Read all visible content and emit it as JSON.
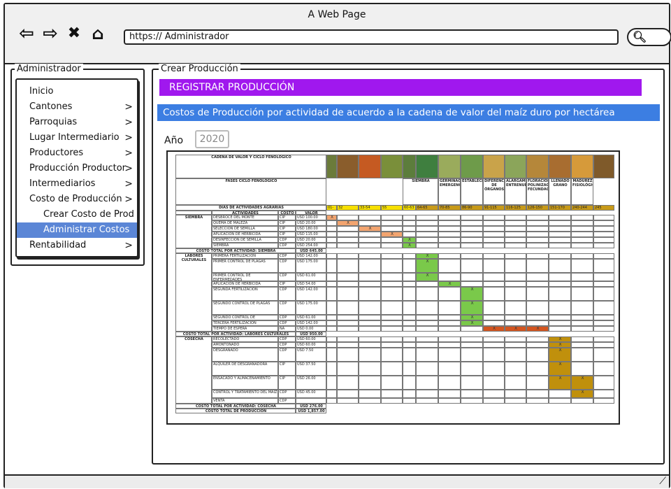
{
  "window": {
    "title": "A Web Page",
    "url": "https:// Administrador"
  },
  "sidebar": {
    "legend": "Administrador",
    "items": [
      {
        "label": "Inicio",
        "chev": ""
      },
      {
        "label": "Cantones",
        "chev": ">"
      },
      {
        "label": "Parroquias",
        "chev": ">"
      },
      {
        "label": "Lugar Intermediario",
        "chev": ">"
      },
      {
        "label": "Productores",
        "chev": ">"
      },
      {
        "label": "Producción Productor",
        "chev": ">"
      },
      {
        "label": "Intermediarios",
        "chev": ">"
      },
      {
        "label": "Costo de Producción",
        "chev": ">"
      },
      {
        "label": "Crear Costo de Prod",
        "chev": ""
      },
      {
        "label": "Administrar Costos d",
        "chev": ""
      },
      {
        "label": "Rentabilidad",
        "chev": ">"
      }
    ]
  },
  "main": {
    "legend": "Crear Producción",
    "banner_title": "REGISTRAR PRODUCCIÓN",
    "banner_subtitle": "Costos de Producción por actividad de acuerdo a la cadena de valor del maíz duro por hectárea",
    "year_label": "Año",
    "year_value": "2020"
  },
  "table": {
    "h1": "CADENA DE VALOR Y CICLO FENOLÓGICO",
    "h2": "FASES CICLO FENOLÓGICO",
    "h3": "DIAS DE ACTIVIDADES AGRARIAS",
    "col_act": "ACTIVIDADES",
    "col_cost": "COSTO",
    "col_val": "VALOR",
    "phases": [
      "SIEMBRA",
      "GERMINACIÓN EMERGENCIA",
      "ESTABLECIMIENTO",
      "DIFERENCIACIÓN DE ÓRGANOS",
      "ALARGAMIENTO ENTRENUDOS",
      "FLORACIÓN POLINIZACIÓN FECUNDACIÓN",
      "LLENADO GRANO",
      "MADUREZ FISIOLÓGICA"
    ],
    "days": [
      "01-02",
      "32",
      "33-54",
      "55",
      "60-63",
      "64-65",
      "70-85",
      "86-90",
      "91-115",
      "116-125",
      "126-150",
      "151-170",
      "240-244",
      "245"
    ],
    "groups": [
      {
        "name": "SIEMBRA",
        "total_label": "COSTO TOTAL POR ACTIVIDAD: SIEMBRA",
        "total": "USD 645.00",
        "rows": [
          [
            "DESBROCE DEL MONTE",
            "CIP",
            "USD 100.00"
          ],
          [
            "QUEMA DE MALEZA",
            "CIP",
            "USD 20.00"
          ],
          [
            "SELECCIÓN DE SEMILLA",
            "CIP",
            "USD 180.00"
          ],
          [
            "APLICACIÓN DE HERBICIDA",
            "CIP",
            "USD 115.00"
          ],
          [
            "DESINFECCIÓN DE SEMILLA",
            "CDP",
            "USD 20.00"
          ],
          [
            "SIEMBRA",
            "CDP",
            "USD 254.00"
          ]
        ]
      },
      {
        "name": "LABORES CULTURALES",
        "total_label": "COSTO TOTAL POR ACTIVIDAD: LABORES CULTURALES",
        "total": "USD 950.00",
        "rows": [
          [
            "PRIMERA FERTILIZACIÓN",
            "CDP",
            "USD 142.00"
          ],
          [
            "PRIMER CONTROL DE PLAGAS",
            "CDP",
            "USD 175.00"
          ],
          [
            "PRIMER CONTROL DE ENFERMEDADES",
            "CDP",
            "USD 61.00"
          ],
          [
            "APLICACIÓN DE HERBICIDA",
            "CIP",
            "USD 54.00"
          ],
          [
            "SEGUNDA FERTILIZACIÓN",
            "CDP",
            "USD 142.00"
          ],
          [
            "SEGUNDO CONTROL DE PLAGAS",
            "CDP",
            "USD 175.00"
          ],
          [
            "SEGUNDO CONTROL DE ENFERMEDADES",
            "CDP",
            "USD 61.00"
          ],
          [
            "TERCERA FERTILIZACIÓN",
            "CDP",
            "USD 142.00"
          ],
          [
            "TIEMPO DE ESPERA",
            "NA",
            "USD 0.00"
          ]
        ]
      },
      {
        "name": "COSECHA",
        "total_label": "COSTO TOTAL POR ACTIVIDAD: COSECHA",
        "total": "USD 276.00",
        "rows": [
          [
            "RECOLECTADO",
            "CDP",
            "USD 60.00"
          ],
          [
            "AMONTONADO",
            "CDP",
            "USD 60.00"
          ],
          [
            "DESGRANADO",
            "CDP",
            "USD 7.50"
          ],
          [
            "ALQUILER DE DESGRANADORA",
            "CIP",
            "USD 37.50"
          ],
          [
            "ENSACADO Y ALMACENAMIENTO",
            "CIP",
            "USD 26.00"
          ],
          [
            "CONTROL Y TRATAMIENTO DEL MAÍZ",
            "CDP",
            "USD 45.00"
          ],
          [
            "VENTA",
            "CDP",
            ""
          ]
        ]
      }
    ],
    "grand_total_label": "COSTO TOTAL DE PRODUCCIÓN",
    "grand_total": "USD 1,857.00",
    "mark": "X"
  }
}
